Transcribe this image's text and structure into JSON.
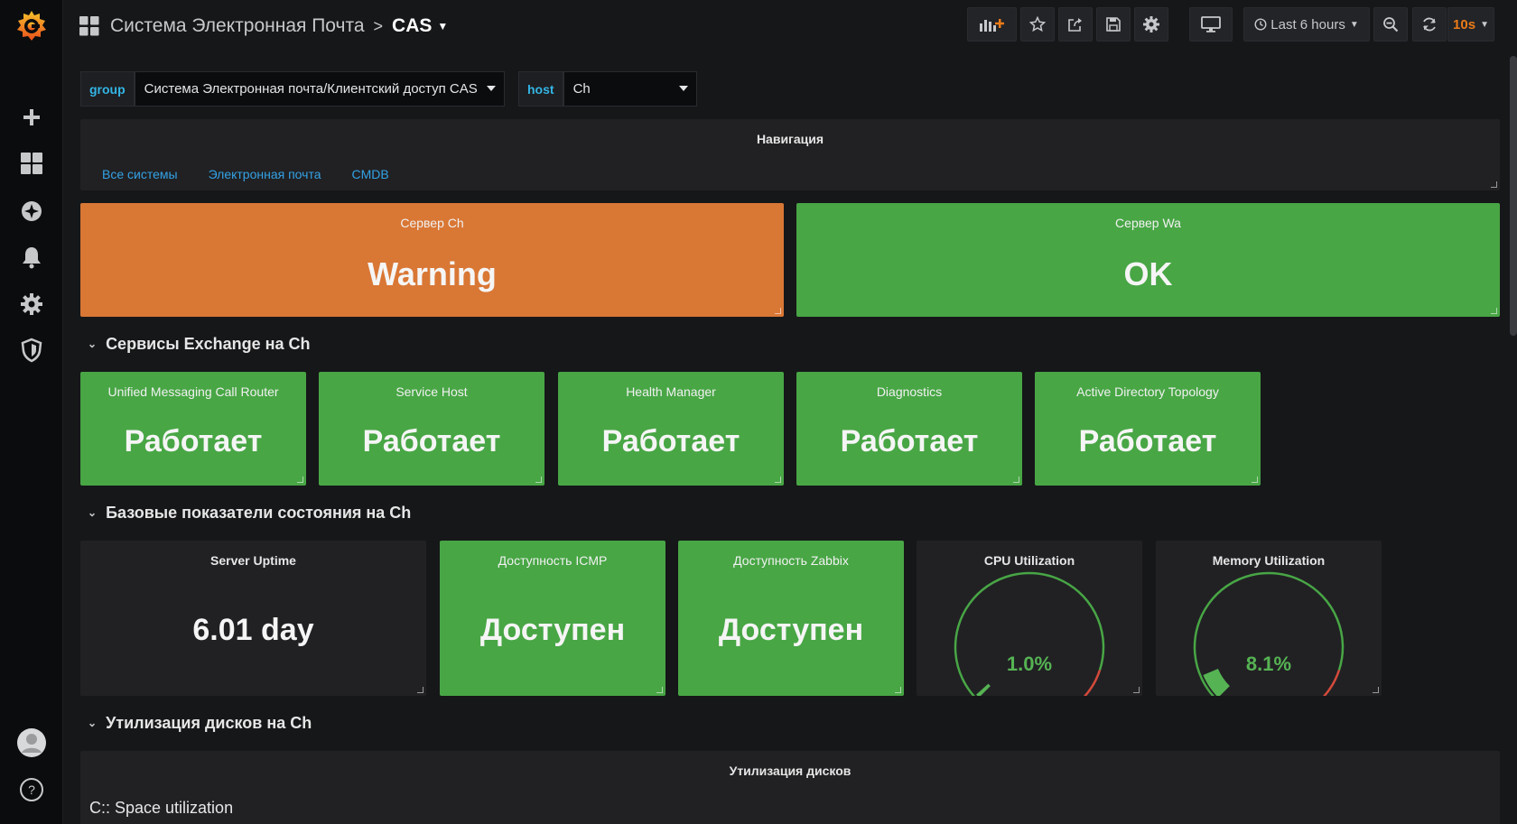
{
  "breadcrumb": {
    "folder": "Система Электронная Почта",
    "separator": ">",
    "dashboard": "CAS"
  },
  "toolbar": {
    "time_range": "Last 6 hours",
    "refresh_interval": "10s",
    "icons": [
      "add-panel-icon",
      "star-icon",
      "share-icon",
      "save-icon",
      "settings-icon",
      "tv-mode-icon",
      "clock-icon",
      "zoom-out-icon",
      "refresh-icon"
    ]
  },
  "sidebar": {
    "icons": [
      "grafana-logo-icon",
      "plus-icon",
      "dashboards-icon",
      "explore-icon",
      "alerting-icon",
      "configuration-icon",
      "shield-icon",
      "avatar-icon",
      "help-icon"
    ]
  },
  "variables": [
    {
      "label": "group",
      "value": "Система Электронная почта/Клиентский доступ CAS"
    },
    {
      "label": "host",
      "value": "Ch"
    }
  ],
  "navigation": {
    "title": "Навигация",
    "links": [
      "Все системы",
      "Электронная почта",
      "CMDB"
    ]
  },
  "servers": [
    {
      "title": "Сервер Ch",
      "value": "Warning",
      "status_color": "#d97735"
    },
    {
      "title": "Сервер Wa",
      "value": "OK",
      "status_color": "#48a645"
    }
  ],
  "rows": [
    {
      "title": "Сервисы Exchange на Ch"
    },
    {
      "title": "Базовые показатели состояния на Ch"
    },
    {
      "title": "Утилизация дисков на Ch"
    }
  ],
  "services": [
    {
      "title": "Unified Messaging Call Router",
      "value": "Работает"
    },
    {
      "title": "Service Host",
      "value": "Работает"
    },
    {
      "title": "Health Manager",
      "value": "Работает"
    },
    {
      "title": "Diagnostics",
      "value": "Работает"
    },
    {
      "title": "Active Directory Topology",
      "value": "Работает"
    }
  ],
  "health": {
    "uptime": {
      "title": "Server Uptime",
      "value": "6.01 day"
    },
    "icmp": {
      "title": "Доступность ICMP",
      "value": "Доступен"
    },
    "zabbix": {
      "title": "Доступность Zabbix",
      "value": "Доступен"
    },
    "cpu": {
      "title": "CPU Utilization",
      "value": "1.0%",
      "level": 1.0
    },
    "memory": {
      "title": "Memory Utilization",
      "value": "8.1%",
      "level": 8.1
    }
  },
  "disks": {
    "title": "Утилизация дисков",
    "space_label": "C:: Space utilization"
  },
  "colors": {
    "ok": "#48a645",
    "warning": "#d97735",
    "link": "#33a2e5",
    "accent": "#eb7b18",
    "variable_label": "#33b5e5"
  }
}
